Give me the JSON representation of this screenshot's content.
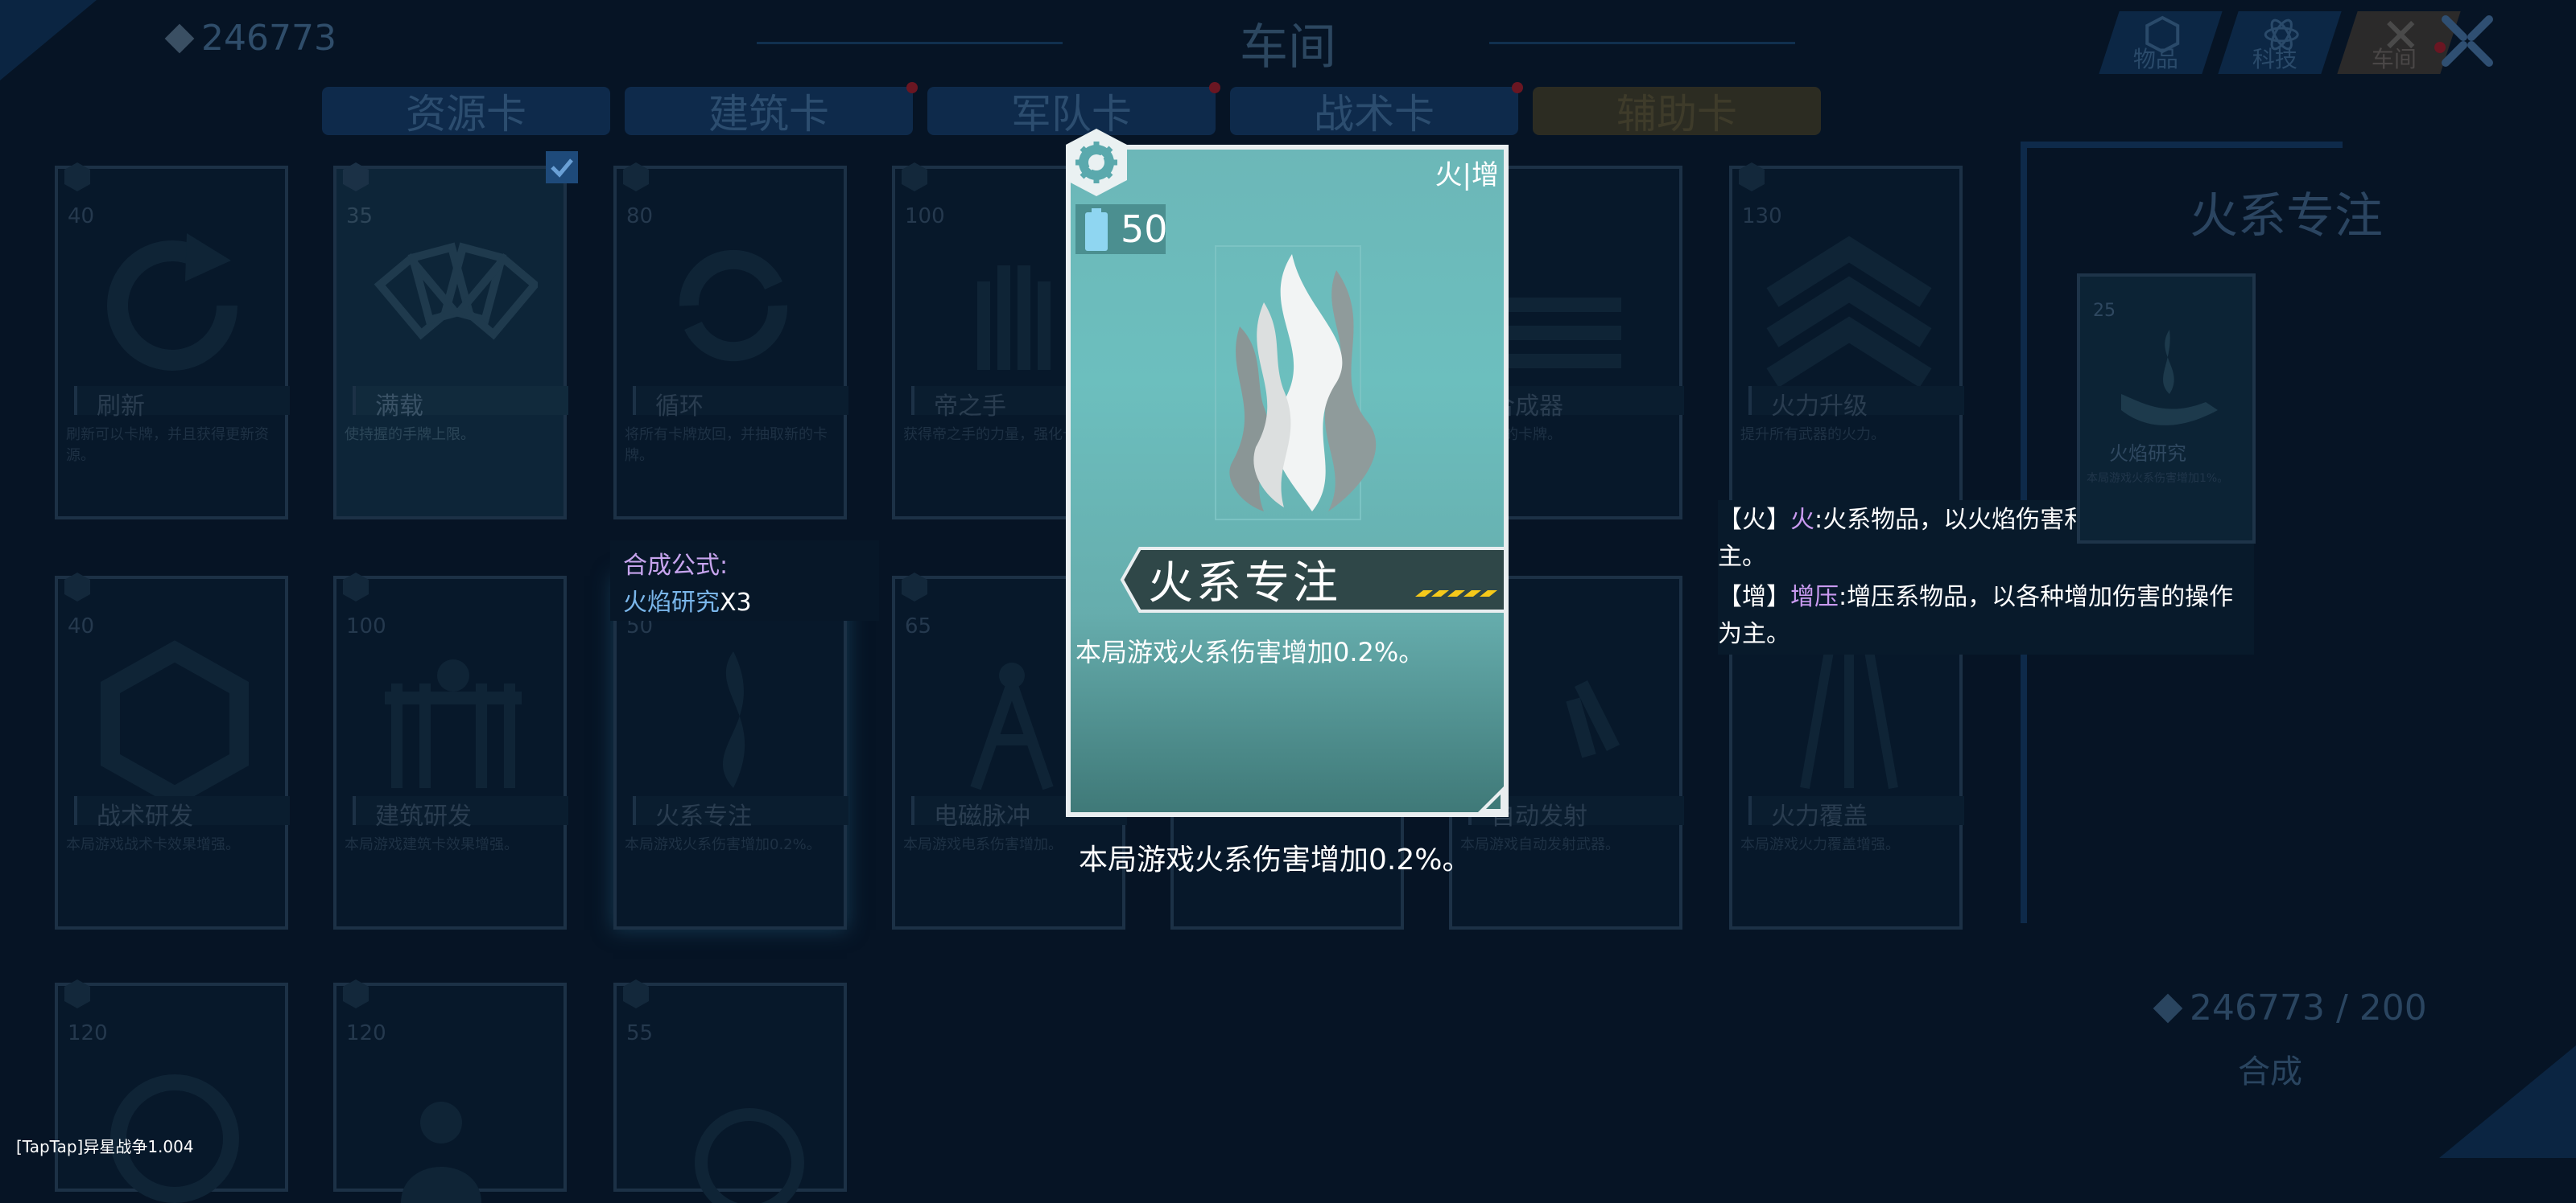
{
  "header": {
    "currency": "246773",
    "title": "车间"
  },
  "tabs": [
    {
      "label": "资源卡",
      "badge": false,
      "active": false
    },
    {
      "label": "建筑卡",
      "badge": true,
      "active": false
    },
    {
      "label": "军队卡",
      "badge": true,
      "active": false
    },
    {
      "label": "战术卡",
      "badge": true,
      "active": false
    },
    {
      "label": "辅助卡",
      "badge": false,
      "active": true
    }
  ],
  "nav": [
    {
      "label": "物品",
      "icon": "items-icon",
      "badge": false
    },
    {
      "label": "科技",
      "icon": "atom-icon",
      "badge": false
    },
    {
      "label": "车间",
      "icon": "workshop-icon",
      "badge": true
    }
  ],
  "grid_cards": [
    {
      "name": "刷新",
      "cost": "40",
      "desc": "刷新可以卡牌，并且获得更新资源。",
      "icon": "refresh-icon"
    },
    {
      "name": "满载",
      "cost": "35",
      "desc": "使持握的手牌上限。",
      "icon": "cards-fan-icon",
      "checked": true
    },
    {
      "name": "循环",
      "cost": "80",
      "desc": "将所有卡牌放回，并抽取新的卡牌。",
      "icon": "cycle-icon"
    },
    {
      "name": "帝之手",
      "cost": "100",
      "desc": "获得帝之手的力量，强化卡牌。",
      "icon": "hand-icon"
    },
    {
      "name": "",
      "cost": "",
      "desc": "",
      "icon": "",
      "hidden": true
    },
    {
      "name": "合成器",
      "cost": "",
      "desc": "合成新的卡牌。",
      "icon": "menu-icon"
    },
    {
      "name": "火力升级",
      "cost": "130",
      "desc": "提升所有武器的火力。",
      "icon": "chevrons-icon"
    },
    {
      "name": "战术研发",
      "cost": "40",
      "desc": "本局游戏战术卡效果增强。",
      "icon": "shield-hex-icon"
    },
    {
      "name": "建筑研发",
      "cost": "100",
      "desc": "本局游戏建筑卡效果增强。",
      "icon": "building-icon"
    },
    {
      "name": "火系专注",
      "cost": "50",
      "desc": "本局游戏火系伤害增加0.2%。",
      "icon": "flame-icon"
    },
    {
      "name": "电磁脉冲",
      "cost": "65",
      "desc": "本局游戏电系伤害增加。",
      "icon": "tower-icon"
    },
    {
      "name": "",
      "cost": "",
      "desc": "",
      "icon": "",
      "hidden": true
    },
    {
      "name": "自动发射",
      "cost": "",
      "desc": "本局游戏自动发射武器。",
      "icon": "missiles-icon"
    },
    {
      "name": "火力覆盖",
      "cost": "",
      "desc": "本局游戏火力覆盖增强。",
      "icon": "arrows-icon"
    },
    {
      "name": "",
      "cost": "120",
      "desc": "",
      "icon": "gear-cluster-icon"
    },
    {
      "name": "",
      "cost": "120",
      "desc": "",
      "icon": "person-music-icon"
    },
    {
      "name": "",
      "cost": "55",
      "desc": "",
      "icon": "stopwatch-icon"
    }
  ],
  "formula": {
    "label": "合成公式:",
    "material": "火焰研究",
    "count": "X3"
  },
  "main_card": {
    "tag": "火|增",
    "cost": "50",
    "name": "火系专注",
    "desc": "本局游戏火系伤害增加0.2%。",
    "caption": "本局游戏火系伤害增加0.2%。"
  },
  "info": {
    "line1_prefix": "【火】",
    "line1_hl": "火",
    "line1_rest": ":火系物品，以火焰伤害和燃烧效果为主。",
    "line2_prefix": "【增】",
    "line2_hl": "增压",
    "line2_rest": ":增压系物品，以各种增加伤害的操作为主。"
  },
  "right_panel": {
    "title": "火系专注",
    "card_cost": "25",
    "card_name": "火焰研究",
    "card_desc": "本局游戏火系伤害增加1%。",
    "amount": "246773 / 200",
    "synth_label": "合成"
  },
  "version": "[TapTap]异星战争1.004",
  "colors": {
    "background": "#061425",
    "card_teal": "#6cb7b8",
    "accent_purple": "#c99af0",
    "accent_blue": "#7ab6ea",
    "energy": "#8fd6f1"
  }
}
